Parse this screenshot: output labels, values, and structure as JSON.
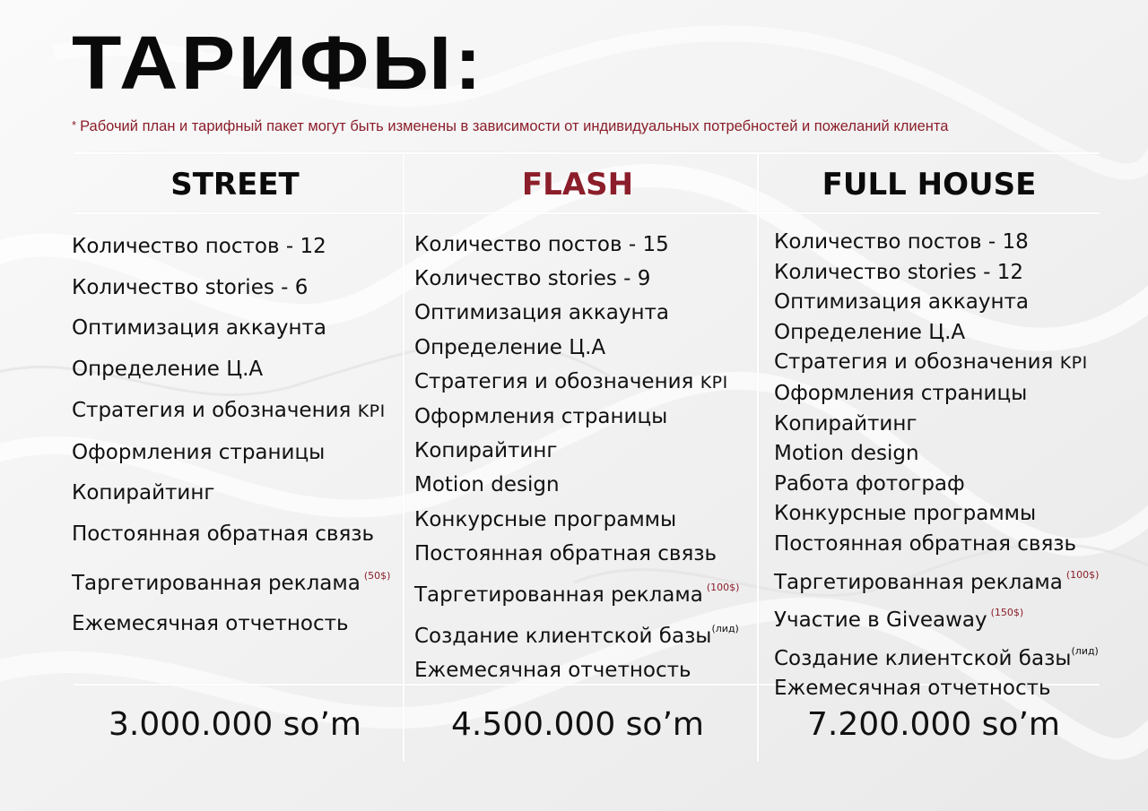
{
  "title": "ТАРИФЫ:",
  "note": {
    "star": "*",
    "text": "Рабочий план и тарифный пакет могут быть изменены в зависимости от индивидуальных потребностей и пожеланий клиента"
  },
  "colors": {
    "accent": "#8b1e2a",
    "text": "#111111",
    "background": "#f2f2f2"
  },
  "plans": [
    {
      "name": "STREET",
      "price": "3.000.000 so’m",
      "features": [
        {
          "text": "Количество постов - 12"
        },
        {
          "text": "Количество stories - 6"
        },
        {
          "text": "Оптимизация аккаунта"
        },
        {
          "text": "Определение Ц.А"
        },
        {
          "text": "Стратегия и обозначения ",
          "kpi": "KPI"
        },
        {
          "text": "Оформления страницы"
        },
        {
          "text": "Копирайтинг"
        },
        {
          "text": "Постоянная обратная связь"
        },
        {
          "text": "Таргетированная реклама",
          "sup": "(50$)"
        },
        {
          "text": "Ежемесячная отчетность"
        }
      ]
    },
    {
      "name": "FLASH",
      "price": "4.500.000 so’m",
      "features": [
        {
          "text": "Количество постов - 15"
        },
        {
          "text": "Количество stories - 9"
        },
        {
          "text": "Оптимизация аккаунта"
        },
        {
          "text": "Определение Ц.А"
        },
        {
          "text": "Стратегия и обозначения ",
          "kpi": "KPI"
        },
        {
          "text": "Оформления страницы"
        },
        {
          "text": "Копирайтинг"
        },
        {
          "text": "Motion design"
        },
        {
          "text": "Конкурсные программы"
        },
        {
          "text": "Постоянная обратная связь"
        },
        {
          "text": "Таргетированная реклама",
          "sup": "(100$)"
        },
        {
          "text": "Создание клиентской базы",
          "sup_black": "(лид)"
        },
        {
          "text": "Ежемесячная отчетность"
        }
      ]
    },
    {
      "name": "FULL HOUSE",
      "price": "7.200.000 so’m",
      "features": [
        {
          "text": "Количество постов - 18"
        },
        {
          "text": "Количество stories - 12"
        },
        {
          "text": "Оптимизация аккаунта"
        },
        {
          "text": "Определение Ц.А"
        },
        {
          "text": "Стратегия и обозначения ",
          "kpi": "KPI"
        },
        {
          "text": "Оформления страницы"
        },
        {
          "text": "Копирайтинг"
        },
        {
          "text": "Motion design"
        },
        {
          "text": "Работа фотограф"
        },
        {
          "text": "Конкурсные программы"
        },
        {
          "text": "Постоянная обратная связь"
        },
        {
          "text": "Таргетированная реклама",
          "sup": "(100$)"
        },
        {
          "text": "Участие в Giveaway",
          "sup": "(150$)"
        },
        {
          "text": "Создание клиентской базы",
          "sup_black": "(лид)"
        },
        {
          "text": "Ежемесячная отчетность"
        }
      ]
    }
  ]
}
